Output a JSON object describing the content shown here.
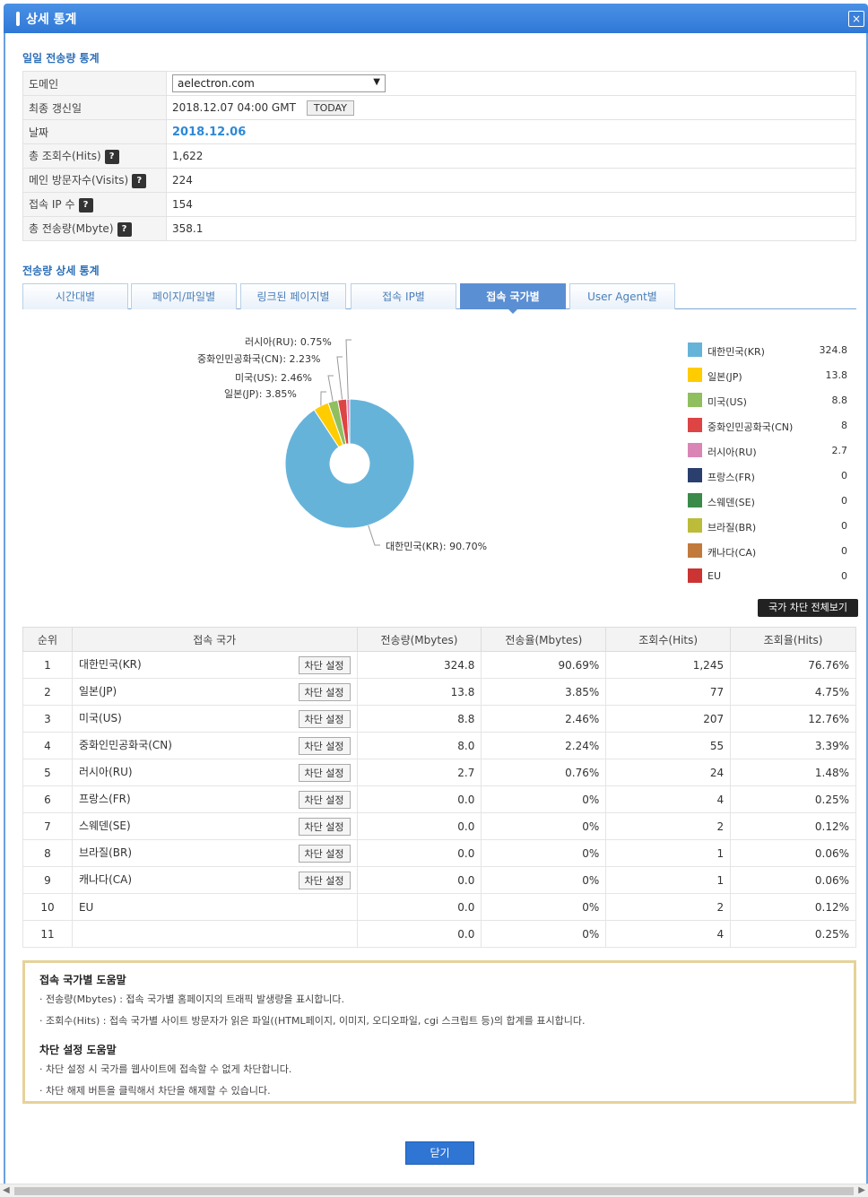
{
  "window": {
    "title": "상세 통계",
    "close_glyph": "×"
  },
  "daily": {
    "section_title": "일일 전송량 통계",
    "rows": {
      "domain_label": "도메인",
      "domain_value": "aelectron.com",
      "updated_label": "최종 갱신일",
      "updated_value": "2018.12.07 04:00 GMT",
      "today_btn": "TODAY",
      "date_label": "날짜",
      "date_value": "2018.12.06",
      "hits_label": "총 조회수(Hits)",
      "hits_value": "1,622",
      "visits_label": "메인 방문자수(Visits)",
      "visits_value": "224",
      "ip_label": "접속 IP 수",
      "ip_value": "154",
      "mbyte_label": "총 전송량(Mbyte)",
      "mbyte_value": "358.1"
    }
  },
  "detail": {
    "section_title": "전송량 상세 통계",
    "tabs": [
      "시간대별",
      "페이지/파일별",
      "링크된 페이지별",
      "접속 IP별",
      "접속 국가별",
      "User Agent별"
    ],
    "active_tab": 4
  },
  "chart_data": {
    "type": "pie",
    "style": "donut",
    "slices": [
      {
        "label": "대한민국(KR)",
        "percent": 90.7,
        "color": "#66b3da",
        "display": "대한민국(KR): 90.70%"
      },
      {
        "label": "일본(JP)",
        "percent": 3.85,
        "color": "#ffcc00",
        "display": "일본(JP): 3.85%"
      },
      {
        "label": "미국(US)",
        "percent": 2.46,
        "color": "#8fbf5f",
        "display": "미국(US): 2.46%"
      },
      {
        "label": "중화인민공화국(CN)",
        "percent": 2.23,
        "color": "#dd4444",
        "display": "중화인민공화국(CN): 2.23%"
      },
      {
        "label": "러시아(RU)",
        "percent": 0.75,
        "color": "#d986b6",
        "display": "러시아(RU): 0.75%"
      }
    ],
    "legend_placement": "right",
    "legend": [
      {
        "name": "대한민국(KR)",
        "value": "324.8",
        "color": "#66b3da"
      },
      {
        "name": "일본(JP)",
        "value": "13.8",
        "color": "#ffcc00"
      },
      {
        "name": "미국(US)",
        "value": "8.8",
        "color": "#8fbf5f"
      },
      {
        "name": "중화인민공화국(CN)",
        "value": "8",
        "color": "#dd4444"
      },
      {
        "name": "러시아(RU)",
        "value": "2.7",
        "color": "#d986b6"
      },
      {
        "name": "프랑스(FR)",
        "value": "0",
        "color": "#2a3f6e"
      },
      {
        "name": "스웨덴(SE)",
        "value": "0",
        "color": "#3a8a4a"
      },
      {
        "name": "브라질(BR)",
        "value": "0",
        "color": "#bcbc3a"
      },
      {
        "name": "캐나다(CA)",
        "value": "0",
        "color": "#c27a3c"
      },
      {
        "name": "EU",
        "value": "0",
        "color": "#cc3333"
      }
    ]
  },
  "block_all_btn": "국가 차단 전체보기",
  "table": {
    "headers": [
      "순위",
      "접속 국가",
      "전송량(Mbytes)",
      "전송율(Mbytes)",
      "조회수(Hits)",
      "조회율(Hits)"
    ],
    "block_btn": "차단 설정",
    "rows": [
      {
        "rank": "1",
        "country": "대한민국(KR)",
        "mbytes": "324.8",
        "mrate": "90.69%",
        "hits": "1,245",
        "hrate": "76.76%",
        "btn": true
      },
      {
        "rank": "2",
        "country": "일본(JP)",
        "mbytes": "13.8",
        "mrate": "3.85%",
        "hits": "77",
        "hrate": "4.75%",
        "btn": true
      },
      {
        "rank": "3",
        "country": "미국(US)",
        "mbytes": "8.8",
        "mrate": "2.46%",
        "hits": "207",
        "hrate": "12.76%",
        "btn": true
      },
      {
        "rank": "4",
        "country": "중화인민공화국(CN)",
        "mbytes": "8.0",
        "mrate": "2.24%",
        "hits": "55",
        "hrate": "3.39%",
        "btn": true
      },
      {
        "rank": "5",
        "country": "러시아(RU)",
        "mbytes": "2.7",
        "mrate": "0.76%",
        "hits": "24",
        "hrate": "1.48%",
        "btn": true
      },
      {
        "rank": "6",
        "country": "프랑스(FR)",
        "mbytes": "0.0",
        "mrate": "0%",
        "hits": "4",
        "hrate": "0.25%",
        "btn": true
      },
      {
        "rank": "7",
        "country": "스웨덴(SE)",
        "mbytes": "0.0",
        "mrate": "0%",
        "hits": "2",
        "hrate": "0.12%",
        "btn": true
      },
      {
        "rank": "8",
        "country": "브라질(BR)",
        "mbytes": "0.0",
        "mrate": "0%",
        "hits": "1",
        "hrate": "0.06%",
        "btn": true
      },
      {
        "rank": "9",
        "country": "캐나다(CA)",
        "mbytes": "0.0",
        "mrate": "0%",
        "hits": "1",
        "hrate": "0.06%",
        "btn": true
      },
      {
        "rank": "10",
        "country": "EU",
        "mbytes": "0.0",
        "mrate": "0%",
        "hits": "2",
        "hrate": "0.12%",
        "btn": false
      },
      {
        "rank": "11",
        "country": "",
        "mbytes": "0.0",
        "mrate": "0%",
        "hits": "4",
        "hrate": "0.25%",
        "btn": false
      }
    ]
  },
  "help": {
    "title1": "접속 국가별 도움말",
    "line1": "· 전송량(Mbytes) : 접속 국가별 홈페이지의 트래픽 발생량을 표시합니다.",
    "line2": "· 조회수(Hits) : 접속 국가별 사이트 방문자가 읽은 파일((HTML페이지, 이미지, 오디오파일, cgi 스크립트 등)의 합계를 표시합니다.",
    "title2": "차단 설정 도움말",
    "line3": "· 차단 설정 시 국가를 웹사이트에 접속할 수 없게 차단합니다.",
    "line4": "· 차단 해제 버튼을 클릭해서 차단을 해제할 수 있습니다."
  },
  "close_btn": "닫기",
  "icons": {
    "question": "?",
    "dropdown": "▼",
    "scroll_left": "◀",
    "scroll_right": "▶"
  }
}
